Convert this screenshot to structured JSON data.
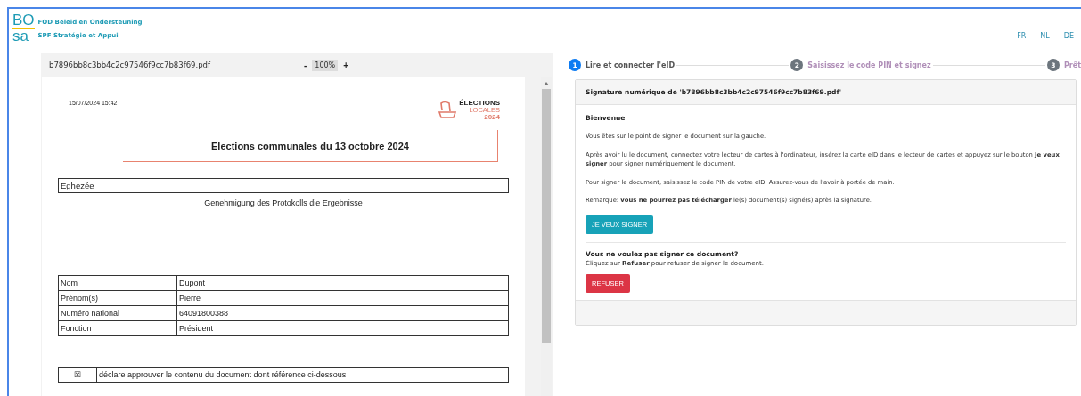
{
  "logo": {
    "top": "BO",
    "bottom": "sa",
    "line_nl": "FOD Beleid en Ondersteuning",
    "line_fr": "SPF Stratégie et Appui"
  },
  "languages": [
    "FR",
    "NL",
    "DE"
  ],
  "viewer": {
    "filename": "b7896bb8c3bb4c2c97546f9cc7b83f69.pdf",
    "zoom_out": "-",
    "zoom": "100%",
    "zoom_in": "+"
  },
  "document": {
    "timestamp": "15/07/2024 15:42",
    "badge": {
      "line1": "ÉLECTIONS",
      "line2": "LOCALES",
      "line3": "2024"
    },
    "title": "Elections communales du 13 octobre 2024",
    "municipality": "Eghezée",
    "subtitle": "Genehmigung des Protokolls die Ergebnisse",
    "rows": [
      {
        "label": "Nom",
        "value": "Dupont"
      },
      {
        "label": "Prénom(s)",
        "value": "Pierre"
      },
      {
        "label": "Numéro national",
        "value": "64091800388"
      },
      {
        "label": "Fonction",
        "value": "Président"
      }
    ],
    "declaration": {
      "mark": "☒",
      "text": "déclare approuver le contenu du document dont référence ci-dessous"
    }
  },
  "steps": [
    {
      "number": "1",
      "label": "Lire et connecter l'eID",
      "selected": true
    },
    {
      "number": "2",
      "label": "Saisissez le code PIN et signez",
      "selected": false
    },
    {
      "number": "3",
      "label": "Prêt",
      "selected": false
    }
  ],
  "card": {
    "title": "Signature numérique de 'b7896bb8c3bb4c2c97546f9cc7b83f69.pdf'",
    "heading": "Bienvenue",
    "paragraphs": [
      "Vous êtes sur le point de signer le document sur la gauche.",
      "Après avoir lu le document, connectez votre lecteur de cartes à l'ordinateur, insérez la carte eID dans le lecteur de cartes et appuyez sur le bouton **Je veux signer** pour signer numériquement le document.",
      "Pour signer le document, saisissez le code PIN de votre eID. Assurez-vous de l'avoir à portée de main.",
      "Remarque: **vous ne pourrez pas télécharger** le(s) document(s) signé(s) après la signature."
    ],
    "sign_button": "JE VEUX SIGNER",
    "refuse_heading": "Vous ne voulez pas signer ce document?",
    "refuse_text": "Cliquez sur **Refuser** pour refuser de signer le document.",
    "refuse_button": "REFUSER"
  }
}
